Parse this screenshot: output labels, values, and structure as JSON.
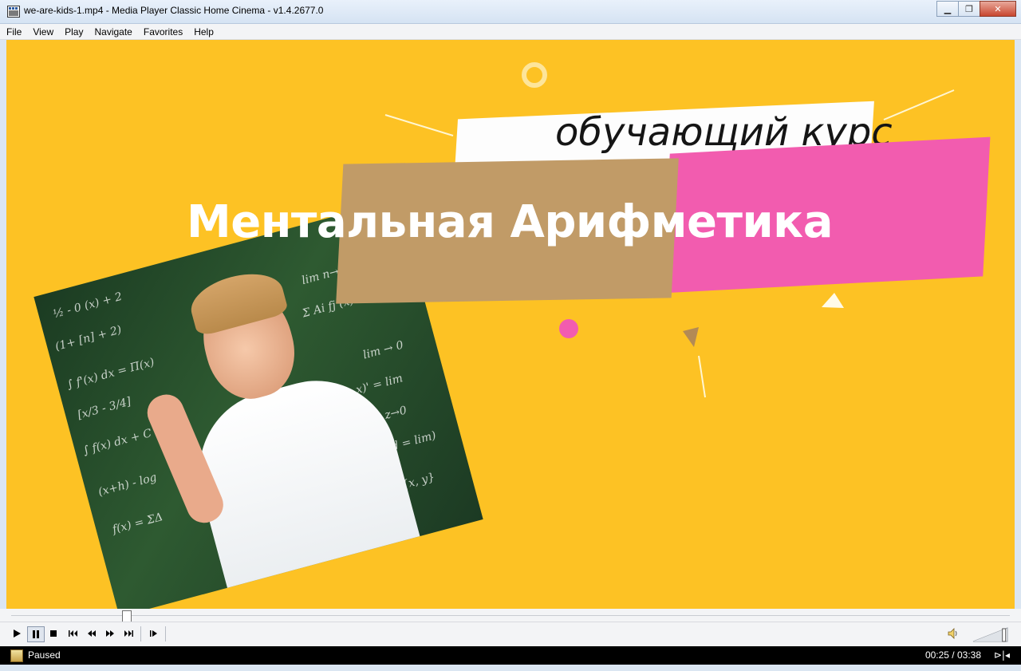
{
  "window": {
    "title": "we-are-kids-1.mp4 - Media Player Classic Home Cinema - v1.4.2677.0",
    "minimize_glyph": "▁",
    "maximize_glyph": "❐",
    "close_glyph": "✕"
  },
  "menu": {
    "items": [
      "File",
      "View",
      "Play",
      "Navigate",
      "Favorites",
      "Help"
    ]
  },
  "video": {
    "subtitle": "обучающий курс",
    "title": "Ментальная Арифметика",
    "background_color": "#fdc224",
    "accent_pink": "#f25caf",
    "accent_tan": "#c19b67",
    "formulas": [
      "½ - 0 (x) + 2",
      "(1+ [n] + 2)",
      "∫ f'(x) dx = Π(x)",
      "[x/3 - 3/4]",
      "∫ f(x) dx + C",
      "Σ Ai fj (x)",
      "lim n→0",
      "lim → 0",
      "(loga x)' = lim",
      "(2n x, d = lim)",
      "f(x) = ΣΔ",
      "(x+h) - log",
      "lim z→0",
      "∑ {x, y}"
    ]
  },
  "seek": {
    "position_fraction": 0.115
  },
  "controls": {
    "play_icon": "play-icon",
    "pause_icon": "pause-icon",
    "stop_icon": "stop-icon",
    "prev_icon": "skip-back-icon",
    "rewind_icon": "rewind-icon",
    "forward_icon": "fast-forward-icon",
    "next_icon": "skip-forward-icon",
    "frame_step_icon": "frame-step-icon",
    "volume_level": 0.9
  },
  "status": {
    "state": "Paused",
    "time": "00:25 / 03:38"
  }
}
